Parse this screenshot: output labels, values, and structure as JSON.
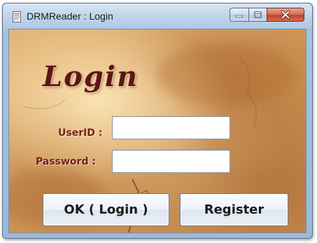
{
  "window": {
    "title": "DRMReader : Login",
    "app_icon": "document-icon",
    "controls": {
      "minimize_icon": "minimize-icon",
      "maximize_icon": "maximize-icon",
      "close_icon": "close-icon"
    }
  },
  "form": {
    "heading": "Login",
    "userid_label": "UserID :",
    "userid_value": "",
    "password_label": "Password :",
    "password_value": "",
    "ok_button": "OK ( Login )",
    "register_button": "Register"
  },
  "colors": {
    "heading": "#5c1616",
    "labels": "#7a1e1e",
    "background": "#d9a466",
    "close_button": "#c2442c"
  }
}
